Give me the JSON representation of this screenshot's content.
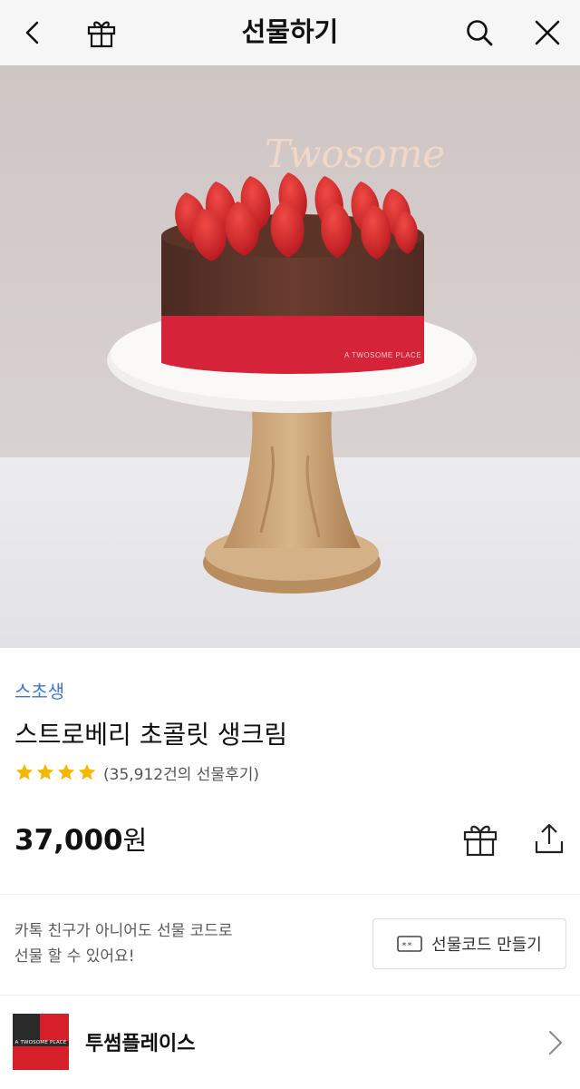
{
  "header": {
    "title": "선물하기",
    "icons": {
      "back": "chevron-left-icon",
      "gift": "gift-icon",
      "search": "search-icon",
      "close": "close-icon"
    }
  },
  "hero": {
    "topper_text": "Twosome",
    "ribbon_text": "A TWOSOME PLACE"
  },
  "product": {
    "brand": "스초생",
    "name": "스트로베리 초콜릿 생크림",
    "rating_stars": 4,
    "review_text": "(35,912건의 선물후기)",
    "price_amount": "37,000",
    "price_unit": "원"
  },
  "gift_code": {
    "note_line1": "카톡 친구가 아니어도 선물 코드로",
    "note_line2": "선물 할 수 있어요!",
    "button_label": "선물코드 만들기",
    "button_icon_text": "**"
  },
  "store": {
    "logo_text": "A TWOSOME PLACE",
    "name": "투썸플레이스"
  },
  "colors": {
    "brand_link": "#3d77d9",
    "star": "#f5b800",
    "ribbon": "#d5233a"
  }
}
